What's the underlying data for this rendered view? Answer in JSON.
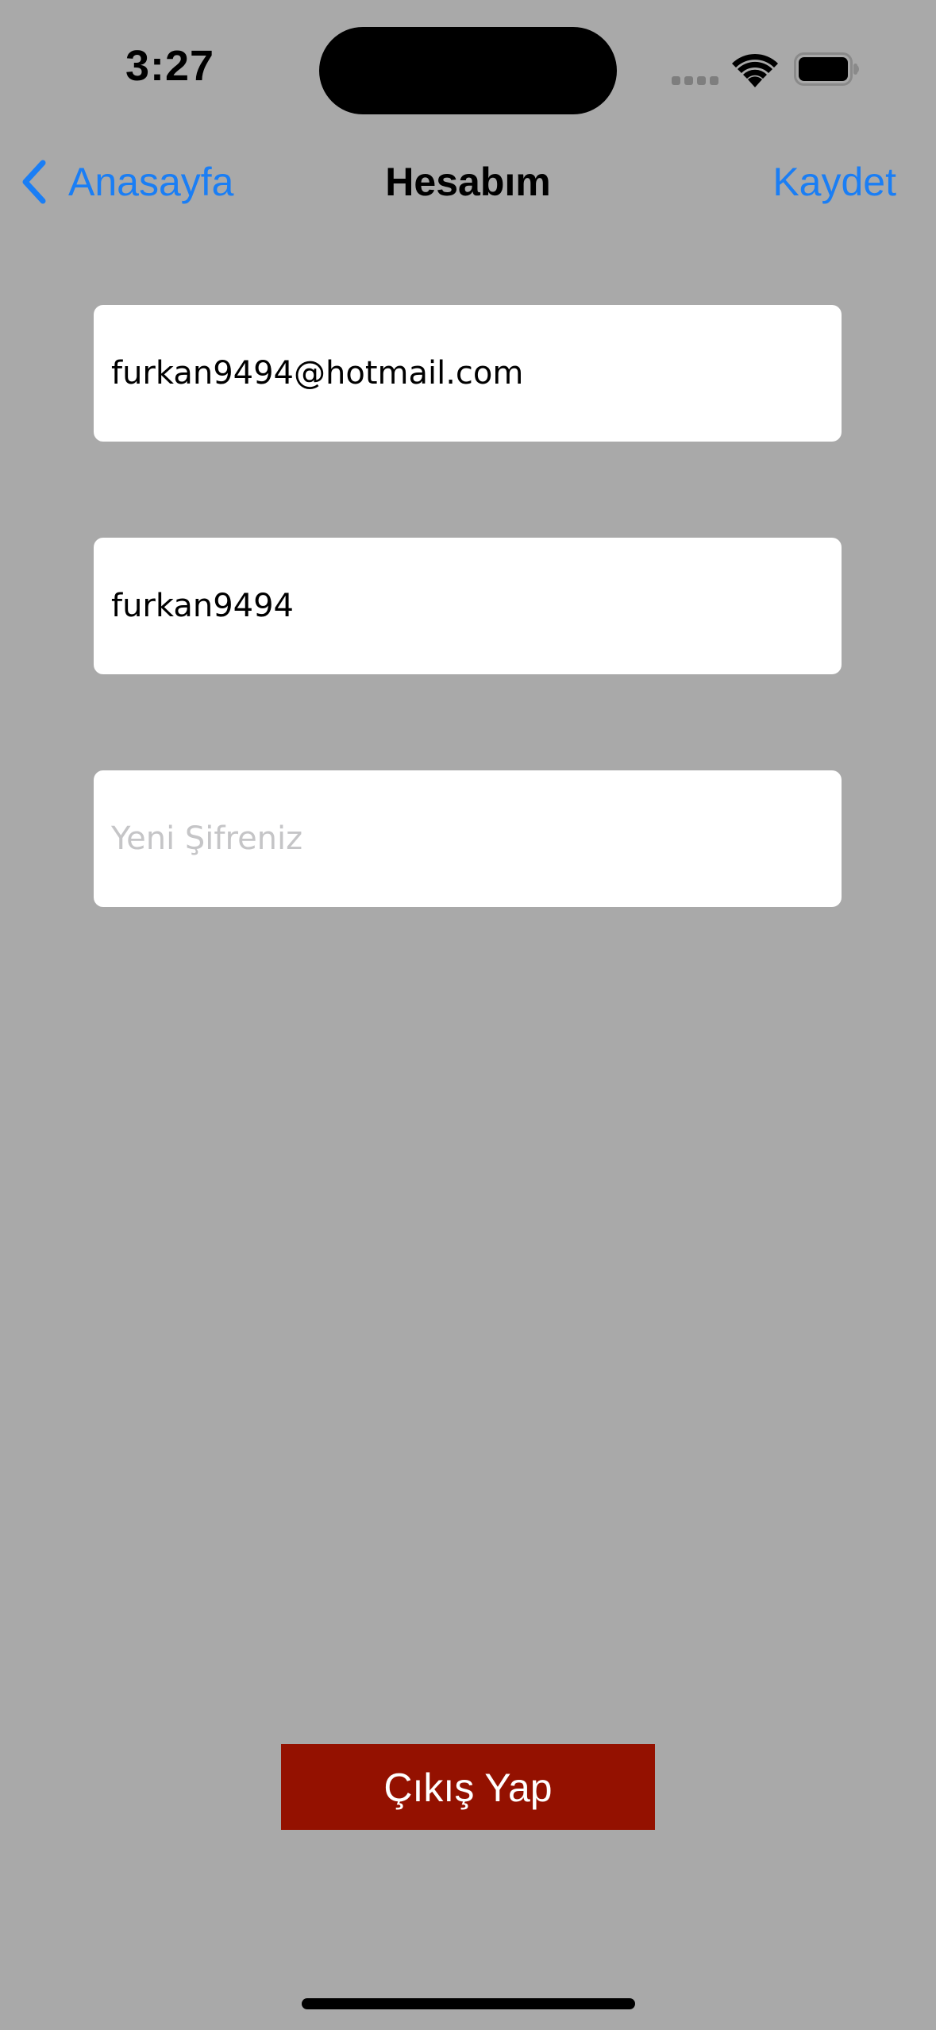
{
  "status_bar": {
    "time": "3:27",
    "icons": [
      "signal-icon",
      "wifi-icon",
      "battery-icon"
    ]
  },
  "nav": {
    "back_label": "Anasayfa",
    "title": "Hesabım",
    "save_label": "Kaydet"
  },
  "form": {
    "email_value": "furkan9494@hotmail.com",
    "username_value": "furkan9494",
    "password_placeholder": "Yeni Şifreniz",
    "password_value": ""
  },
  "logout": {
    "label": "Çıkış Yap"
  },
  "colors": {
    "background": "#a9a9a9",
    "accent": "#1a7ef5",
    "logout_button": "#941100",
    "field_background": "#ffffff"
  }
}
